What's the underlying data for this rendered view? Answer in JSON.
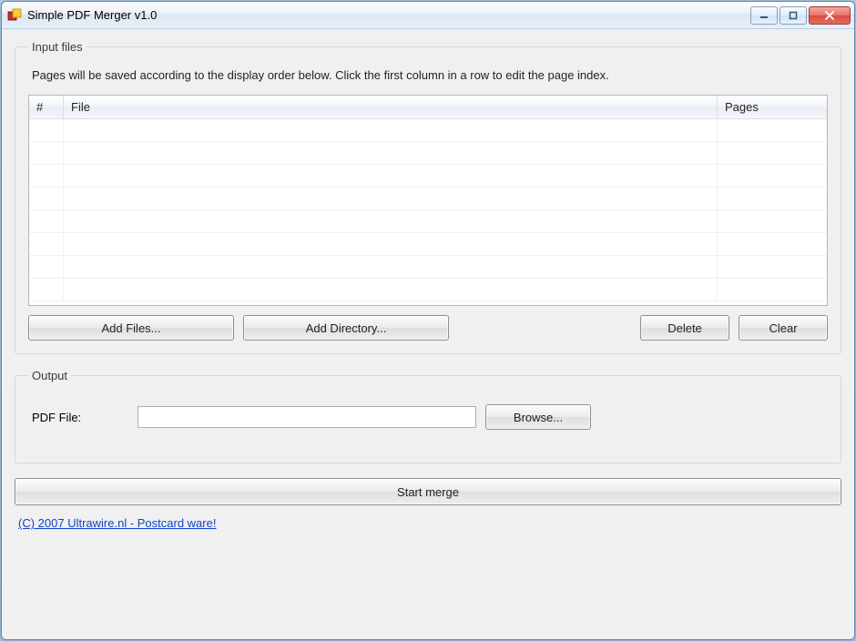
{
  "window": {
    "title": "Simple PDF Merger v1.0"
  },
  "input_group": {
    "legend": "Input files",
    "hint": "Pages will be saved according to the display order below. Click the first column in a row to edit the page index.",
    "columns": {
      "index": "#",
      "file": "File",
      "pages": "Pages"
    },
    "buttons": {
      "add_files": "Add Files...",
      "add_dir": "Add Directory...",
      "delete": "Delete",
      "clear": "Clear"
    }
  },
  "output_group": {
    "legend": "Output",
    "label": "PDF File:",
    "value": "",
    "browse": "Browse..."
  },
  "start_button": "Start merge",
  "footer": "(C) 2007 Ultrawire.nl - Postcard ware!"
}
